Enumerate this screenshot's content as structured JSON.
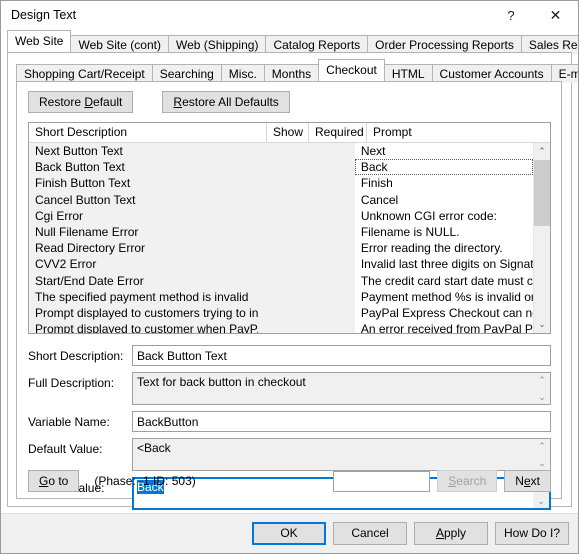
{
  "window": {
    "title": "Design Text",
    "help_label": "?",
    "close_label": "✕"
  },
  "outer_tabs": [
    {
      "label": "Web Site",
      "active": true
    },
    {
      "label": "Web Site (cont)",
      "active": false
    },
    {
      "label": "Web (Shipping)",
      "active": false
    },
    {
      "label": "Catalog Reports",
      "active": false
    },
    {
      "label": "Order Processing Reports",
      "active": false
    },
    {
      "label": "Sales Reports",
      "active": false
    }
  ],
  "inner_tabs": [
    {
      "label": "Shopping Cart/Receipt",
      "active": false
    },
    {
      "label": "Searching",
      "active": false
    },
    {
      "label": "Misc.",
      "active": false
    },
    {
      "label": "Months",
      "active": false
    },
    {
      "label": "Checkout",
      "active": true
    },
    {
      "label": "HTML",
      "active": false
    },
    {
      "label": "Customer Accounts",
      "active": false
    },
    {
      "label": "E-mail",
      "active": false
    }
  ],
  "toolbar": {
    "restore_default": {
      "pre": "Restore ",
      "accel": "D",
      "post": "efault"
    },
    "restore_all_defaults": {
      "pre": "",
      "accel": "R",
      "post": "estore All Defaults"
    }
  },
  "list": {
    "columns": [
      "Short Description",
      "Show",
      "Required",
      "Prompt"
    ],
    "rows": [
      {
        "desc": "Next Button Text",
        "show": "",
        "required": "",
        "prompt": "Next",
        "selected": false
      },
      {
        "desc": "Back Button Text",
        "show": "",
        "required": "",
        "prompt": "Back",
        "selected": true
      },
      {
        "desc": "Finish Button Text",
        "show": "",
        "required": "",
        "prompt": "Finish",
        "selected": false
      },
      {
        "desc": "Cancel Button Text",
        "show": "",
        "required": "",
        "prompt": "Cancel",
        "selected": false
      },
      {
        "desc": "Cgi Error",
        "show": "",
        "required": "",
        "prompt": "Unknown CGI error code:",
        "selected": false
      },
      {
        "desc": "Null Filename Error",
        "show": "",
        "required": "",
        "prompt": "Filename is NULL.",
        "selected": false
      },
      {
        "desc": "Read Directory Error",
        "show": "",
        "required": "",
        "prompt": "Error reading the directory.",
        "selected": false
      },
      {
        "desc": "CVV2 Error",
        "show": "",
        "required": "",
        "prompt": "Invalid last three digits on Signature Strip, ...",
        "selected": false
      },
      {
        "desc": "Start/End Date Error",
        "show": "",
        "required": "",
        "prompt": "The credit card start date must come befo...",
        "selected": false
      },
      {
        "desc": "The specified payment method is invalid",
        "show": "",
        "required": "",
        "prompt": "Payment method %s is invalid or may hav...",
        "selected": false
      },
      {
        "desc": "Prompt displayed to customers trying to in...",
        "show": "",
        "required": "",
        "prompt": "PayPal Express Checkout can not be use...",
        "selected": false
      },
      {
        "desc": "Prompt displayed to customer when PayP...",
        "show": "",
        "required": "",
        "prompt": "An error received from PayPal Pro Websit...",
        "selected": false
      }
    ],
    "scroll_up_icon": "⌃",
    "scroll_down_icon": "⌄"
  },
  "form": {
    "short_description": {
      "label": "Short Description:",
      "value": "Back Button Text"
    },
    "full_description": {
      "label": "Full Description:",
      "value": "Text for back button in checkout"
    },
    "variable_name": {
      "label": "Variable Name:",
      "value": "BackButton"
    },
    "default_value": {
      "label": "Default Value:",
      "value": "<Back"
    },
    "current_value": {
      "label": "Current Value:",
      "value": "Back"
    },
    "scroll_up_icon": "⌃",
    "scroll_down_icon": "⌄"
  },
  "goto_bar": {
    "goto_button": {
      "accel": "G",
      "post": "o to"
    },
    "status": "(Phase: -1   ID: 503)",
    "search_input_value": "",
    "search_button": {
      "accel": "S",
      "post": "earch",
      "disabled": true
    },
    "next_button": {
      "pre": "N",
      "accel": "e",
      "post": "xt"
    }
  },
  "footer": {
    "ok": "OK",
    "cancel": "Cancel",
    "apply": {
      "pre": "",
      "accel": "A",
      "post": "pply"
    },
    "how_do_i": "How Do I?"
  },
  "colors": {
    "accent": "#0078d7",
    "selection": "#0078d7",
    "panel": "#f0f0f0",
    "list_alt": "#f1f1f1"
  }
}
